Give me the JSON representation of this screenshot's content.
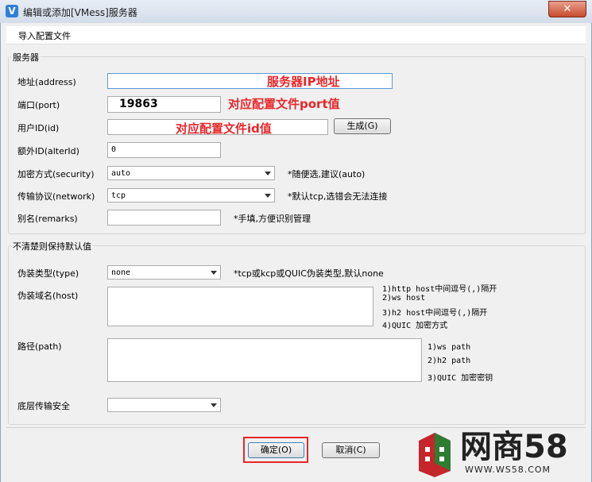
{
  "window": {
    "title": "编辑或添加[VMess]服务器",
    "close": "✕"
  },
  "menu": {
    "import": "导入配置文件"
  },
  "server_group": {
    "title": "服务器",
    "address": {
      "label": "地址(address)",
      "value": ""
    },
    "port": {
      "label": "端口(port)",
      "value": "19863"
    },
    "id": {
      "label": "用户ID(id)",
      "value": "",
      "generate": "生成(G)"
    },
    "alter_id": {
      "label": "额外ID(alterId)",
      "value": "0"
    },
    "security": {
      "label": "加密方式(security)",
      "value": "auto",
      "hint": "*随便选,建议(auto)"
    },
    "network": {
      "label": "传输协议(network)",
      "value": "tcp",
      "hint": "*默认tcp,选错会无法连接"
    },
    "remarks": {
      "label": "别名(remarks)",
      "value": "",
      "hint": "*手填,方便识别管理"
    }
  },
  "default_group": {
    "title": "不清楚则保持默认值",
    "type": {
      "label": "伪装类型(type)",
      "value": "none",
      "hint": "*tcp或kcp或QUIC伪装类型,默认none"
    },
    "host": {
      "label": "伪装域名(host)",
      "value": "",
      "hints": [
        "1)http host中间逗号(,)隔开",
        "2)ws host",
        "3)h2 host中间逗号(,)隔开",
        "4)QUIC 加密方式"
      ]
    },
    "path": {
      "label": "路径(path)",
      "value": "",
      "hints": [
        "1)ws path",
        "2)h2 path",
        "3)QUIC 加密密钥"
      ]
    },
    "tls": {
      "label": "底层传输安全",
      "value": ""
    }
  },
  "buttons": {
    "ok": "确定(O)",
    "cancel": "取消(C)"
  },
  "annotations": {
    "address": "服务器IP地址",
    "port": "对应配置文件port值",
    "id": "对应配置文件id值"
  },
  "watermark": {
    "brand": "网商58",
    "url": "WWW.WS58.COM"
  },
  "colors": {
    "annotation": "#e8262a",
    "logo_red": "#c4262b",
    "logo_green": "#2e7d32"
  }
}
